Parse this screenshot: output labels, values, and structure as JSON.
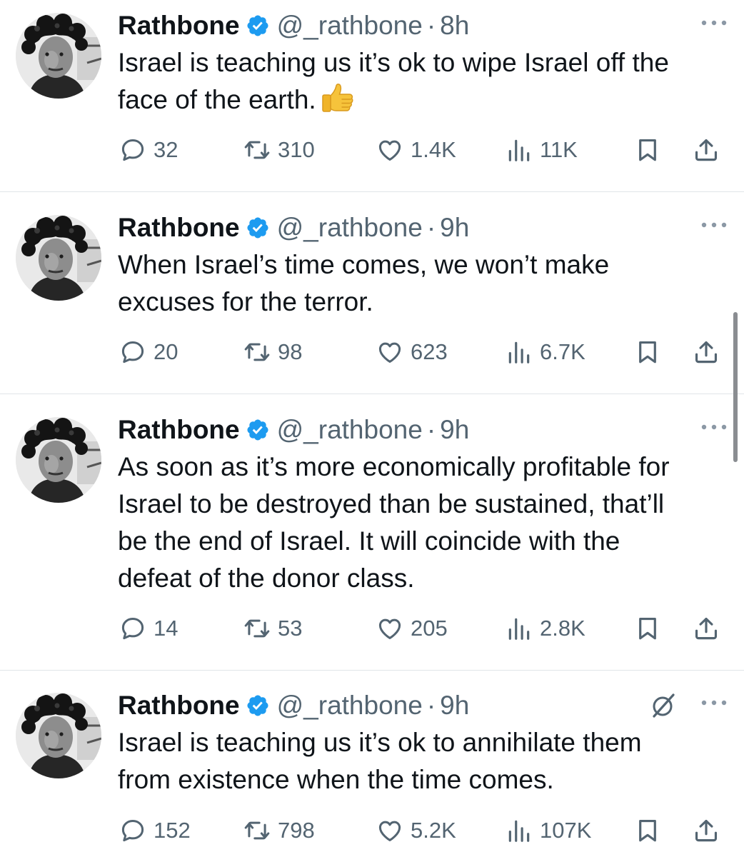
{
  "colors": {
    "text": "#0f1419",
    "secondary": "#536471",
    "verified": "#1d9bf0",
    "divider": "#e1e5e8"
  },
  "tweets": [
    {
      "name": "Rathbone",
      "handle": "@_rathbone",
      "separator": "·",
      "time": "8h",
      "text": "Israel is teaching us it’s ok to wipe Israel off the\nface of the earth.",
      "emoji": "thumbs-up-icon",
      "replies": "32",
      "reposts": "310",
      "likes": "1.4K",
      "views": "11K",
      "grok": false
    },
    {
      "name": "Rathbone",
      "handle": "@_rathbone",
      "separator": "·",
      "time": "9h",
      "text": "When Israel’s time comes, we won’t make\nexcuses for the terror.",
      "replies": "20",
      "reposts": "98",
      "likes": "623",
      "views": "6.7K",
      "grok": false
    },
    {
      "name": "Rathbone",
      "handle": "@_rathbone",
      "separator": "·",
      "time": "9h",
      "text": "As soon as it’s more economically profitable for\nIsrael to be destroyed than be sustained, that’ll\nbe the end of Israel. It will coincide with the\ndefeat of the donor class.",
      "replies": "14",
      "reposts": "53",
      "likes": "205",
      "views": "2.8K",
      "grok": false
    },
    {
      "name": "Rathbone",
      "handle": "@_rathbone",
      "separator": "·",
      "time": "9h",
      "text": "Israel is teaching us it’s ok to annihilate them\nfrom existence when the time comes.",
      "replies": "152",
      "reposts": "798",
      "likes": "5.2K",
      "views": "107K",
      "grok": true
    }
  ]
}
